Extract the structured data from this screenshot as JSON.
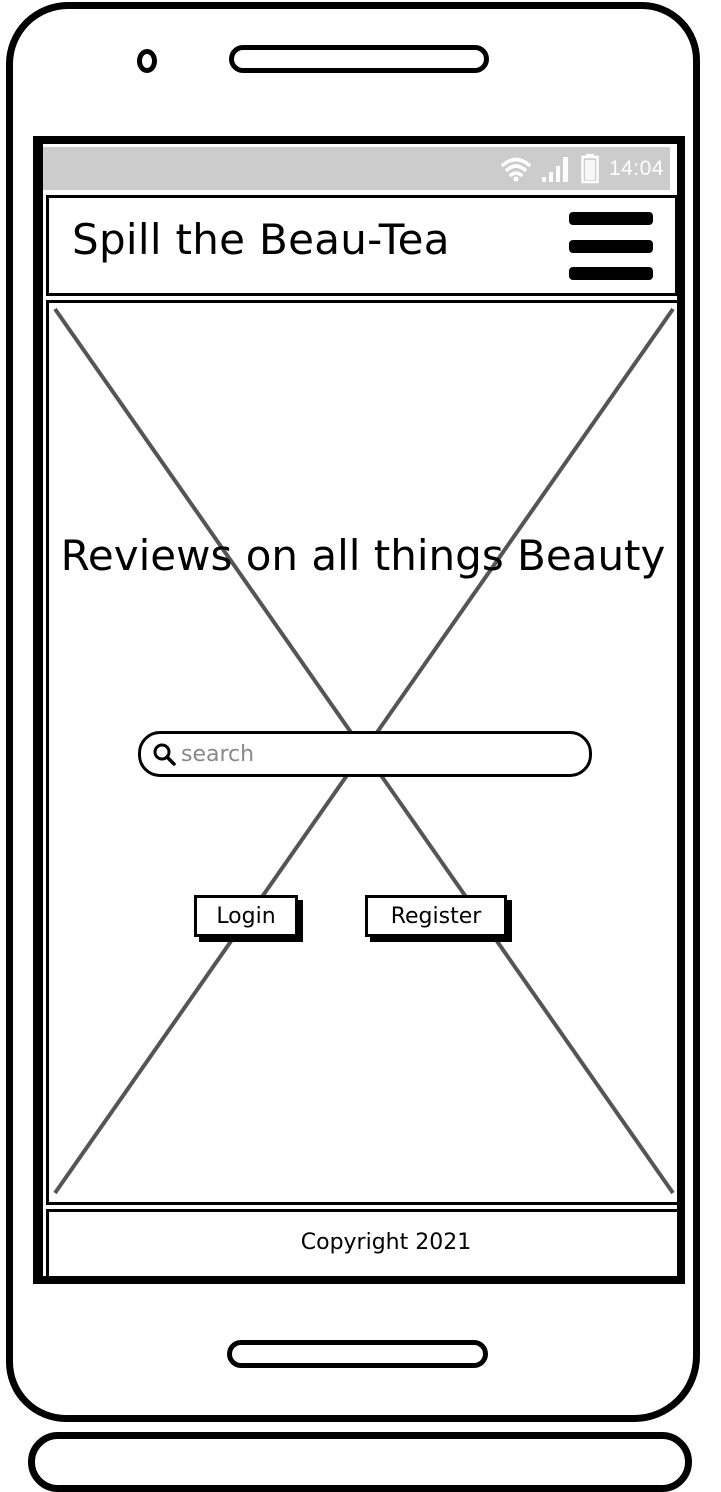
{
  "status_bar": {
    "time": "14:04",
    "icons": [
      "wifi-icon",
      "signal-icon",
      "battery-icon"
    ]
  },
  "header": {
    "title": "Spill the Beau-Tea",
    "menu_icon": "hamburger-menu-icon"
  },
  "hero": {
    "image_placeholder": "image-placeholder-x",
    "title": "Reviews on all things Beauty",
    "search": {
      "placeholder": "search",
      "value": ""
    },
    "buttons": {
      "login": "Login",
      "register": "Register"
    }
  },
  "footer": {
    "copyright": "Copyright 2021"
  },
  "colors": {
    "status_bar_bg": "#cccccc",
    "placeholder_lines": "#555555",
    "ink": "#000000"
  }
}
